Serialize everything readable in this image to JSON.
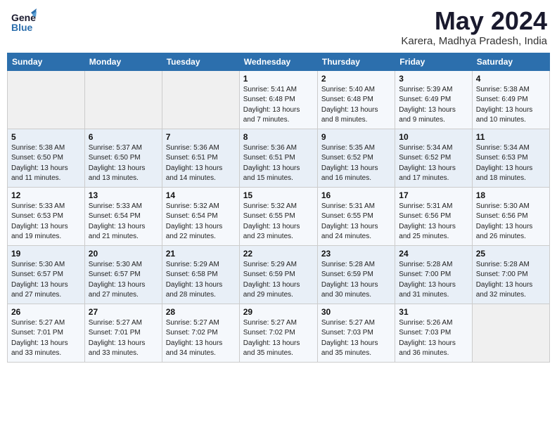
{
  "logo": {
    "line1": "General",
    "line2": "Blue"
  },
  "title": "May 2024",
  "subtitle": "Karera, Madhya Pradesh, India",
  "headers": [
    "Sunday",
    "Monday",
    "Tuesday",
    "Wednesday",
    "Thursday",
    "Friday",
    "Saturday"
  ],
  "weeks": [
    [
      {
        "day": "",
        "info": ""
      },
      {
        "day": "",
        "info": ""
      },
      {
        "day": "",
        "info": ""
      },
      {
        "day": "1",
        "info": "Sunrise: 5:41 AM\nSunset: 6:48 PM\nDaylight: 13 hours\nand 7 minutes."
      },
      {
        "day": "2",
        "info": "Sunrise: 5:40 AM\nSunset: 6:48 PM\nDaylight: 13 hours\nand 8 minutes."
      },
      {
        "day": "3",
        "info": "Sunrise: 5:39 AM\nSunset: 6:49 PM\nDaylight: 13 hours\nand 9 minutes."
      },
      {
        "day": "4",
        "info": "Sunrise: 5:38 AM\nSunset: 6:49 PM\nDaylight: 13 hours\nand 10 minutes."
      }
    ],
    [
      {
        "day": "5",
        "info": "Sunrise: 5:38 AM\nSunset: 6:50 PM\nDaylight: 13 hours\nand 11 minutes."
      },
      {
        "day": "6",
        "info": "Sunrise: 5:37 AM\nSunset: 6:50 PM\nDaylight: 13 hours\nand 13 minutes."
      },
      {
        "day": "7",
        "info": "Sunrise: 5:36 AM\nSunset: 6:51 PM\nDaylight: 13 hours\nand 14 minutes."
      },
      {
        "day": "8",
        "info": "Sunrise: 5:36 AM\nSunset: 6:51 PM\nDaylight: 13 hours\nand 15 minutes."
      },
      {
        "day": "9",
        "info": "Sunrise: 5:35 AM\nSunset: 6:52 PM\nDaylight: 13 hours\nand 16 minutes."
      },
      {
        "day": "10",
        "info": "Sunrise: 5:34 AM\nSunset: 6:52 PM\nDaylight: 13 hours\nand 17 minutes."
      },
      {
        "day": "11",
        "info": "Sunrise: 5:34 AM\nSunset: 6:53 PM\nDaylight: 13 hours\nand 18 minutes."
      }
    ],
    [
      {
        "day": "12",
        "info": "Sunrise: 5:33 AM\nSunset: 6:53 PM\nDaylight: 13 hours\nand 19 minutes."
      },
      {
        "day": "13",
        "info": "Sunrise: 5:33 AM\nSunset: 6:54 PM\nDaylight: 13 hours\nand 21 minutes."
      },
      {
        "day": "14",
        "info": "Sunrise: 5:32 AM\nSunset: 6:54 PM\nDaylight: 13 hours\nand 22 minutes."
      },
      {
        "day": "15",
        "info": "Sunrise: 5:32 AM\nSunset: 6:55 PM\nDaylight: 13 hours\nand 23 minutes."
      },
      {
        "day": "16",
        "info": "Sunrise: 5:31 AM\nSunset: 6:55 PM\nDaylight: 13 hours\nand 24 minutes."
      },
      {
        "day": "17",
        "info": "Sunrise: 5:31 AM\nSunset: 6:56 PM\nDaylight: 13 hours\nand 25 minutes."
      },
      {
        "day": "18",
        "info": "Sunrise: 5:30 AM\nSunset: 6:56 PM\nDaylight: 13 hours\nand 26 minutes."
      }
    ],
    [
      {
        "day": "19",
        "info": "Sunrise: 5:30 AM\nSunset: 6:57 PM\nDaylight: 13 hours\nand 27 minutes."
      },
      {
        "day": "20",
        "info": "Sunrise: 5:30 AM\nSunset: 6:57 PM\nDaylight: 13 hours\nand 27 minutes."
      },
      {
        "day": "21",
        "info": "Sunrise: 5:29 AM\nSunset: 6:58 PM\nDaylight: 13 hours\nand 28 minutes."
      },
      {
        "day": "22",
        "info": "Sunrise: 5:29 AM\nSunset: 6:59 PM\nDaylight: 13 hours\nand 29 minutes."
      },
      {
        "day": "23",
        "info": "Sunrise: 5:28 AM\nSunset: 6:59 PM\nDaylight: 13 hours\nand 30 minutes."
      },
      {
        "day": "24",
        "info": "Sunrise: 5:28 AM\nSunset: 7:00 PM\nDaylight: 13 hours\nand 31 minutes."
      },
      {
        "day": "25",
        "info": "Sunrise: 5:28 AM\nSunset: 7:00 PM\nDaylight: 13 hours\nand 32 minutes."
      }
    ],
    [
      {
        "day": "26",
        "info": "Sunrise: 5:27 AM\nSunset: 7:01 PM\nDaylight: 13 hours\nand 33 minutes."
      },
      {
        "day": "27",
        "info": "Sunrise: 5:27 AM\nSunset: 7:01 PM\nDaylight: 13 hours\nand 33 minutes."
      },
      {
        "day": "28",
        "info": "Sunrise: 5:27 AM\nSunset: 7:02 PM\nDaylight: 13 hours\nand 34 minutes."
      },
      {
        "day": "29",
        "info": "Sunrise: 5:27 AM\nSunset: 7:02 PM\nDaylight: 13 hours\nand 35 minutes."
      },
      {
        "day": "30",
        "info": "Sunrise: 5:27 AM\nSunset: 7:03 PM\nDaylight: 13 hours\nand 35 minutes."
      },
      {
        "day": "31",
        "info": "Sunrise: 5:26 AM\nSunset: 7:03 PM\nDaylight: 13 hours\nand 36 minutes."
      },
      {
        "day": "",
        "info": ""
      }
    ]
  ]
}
